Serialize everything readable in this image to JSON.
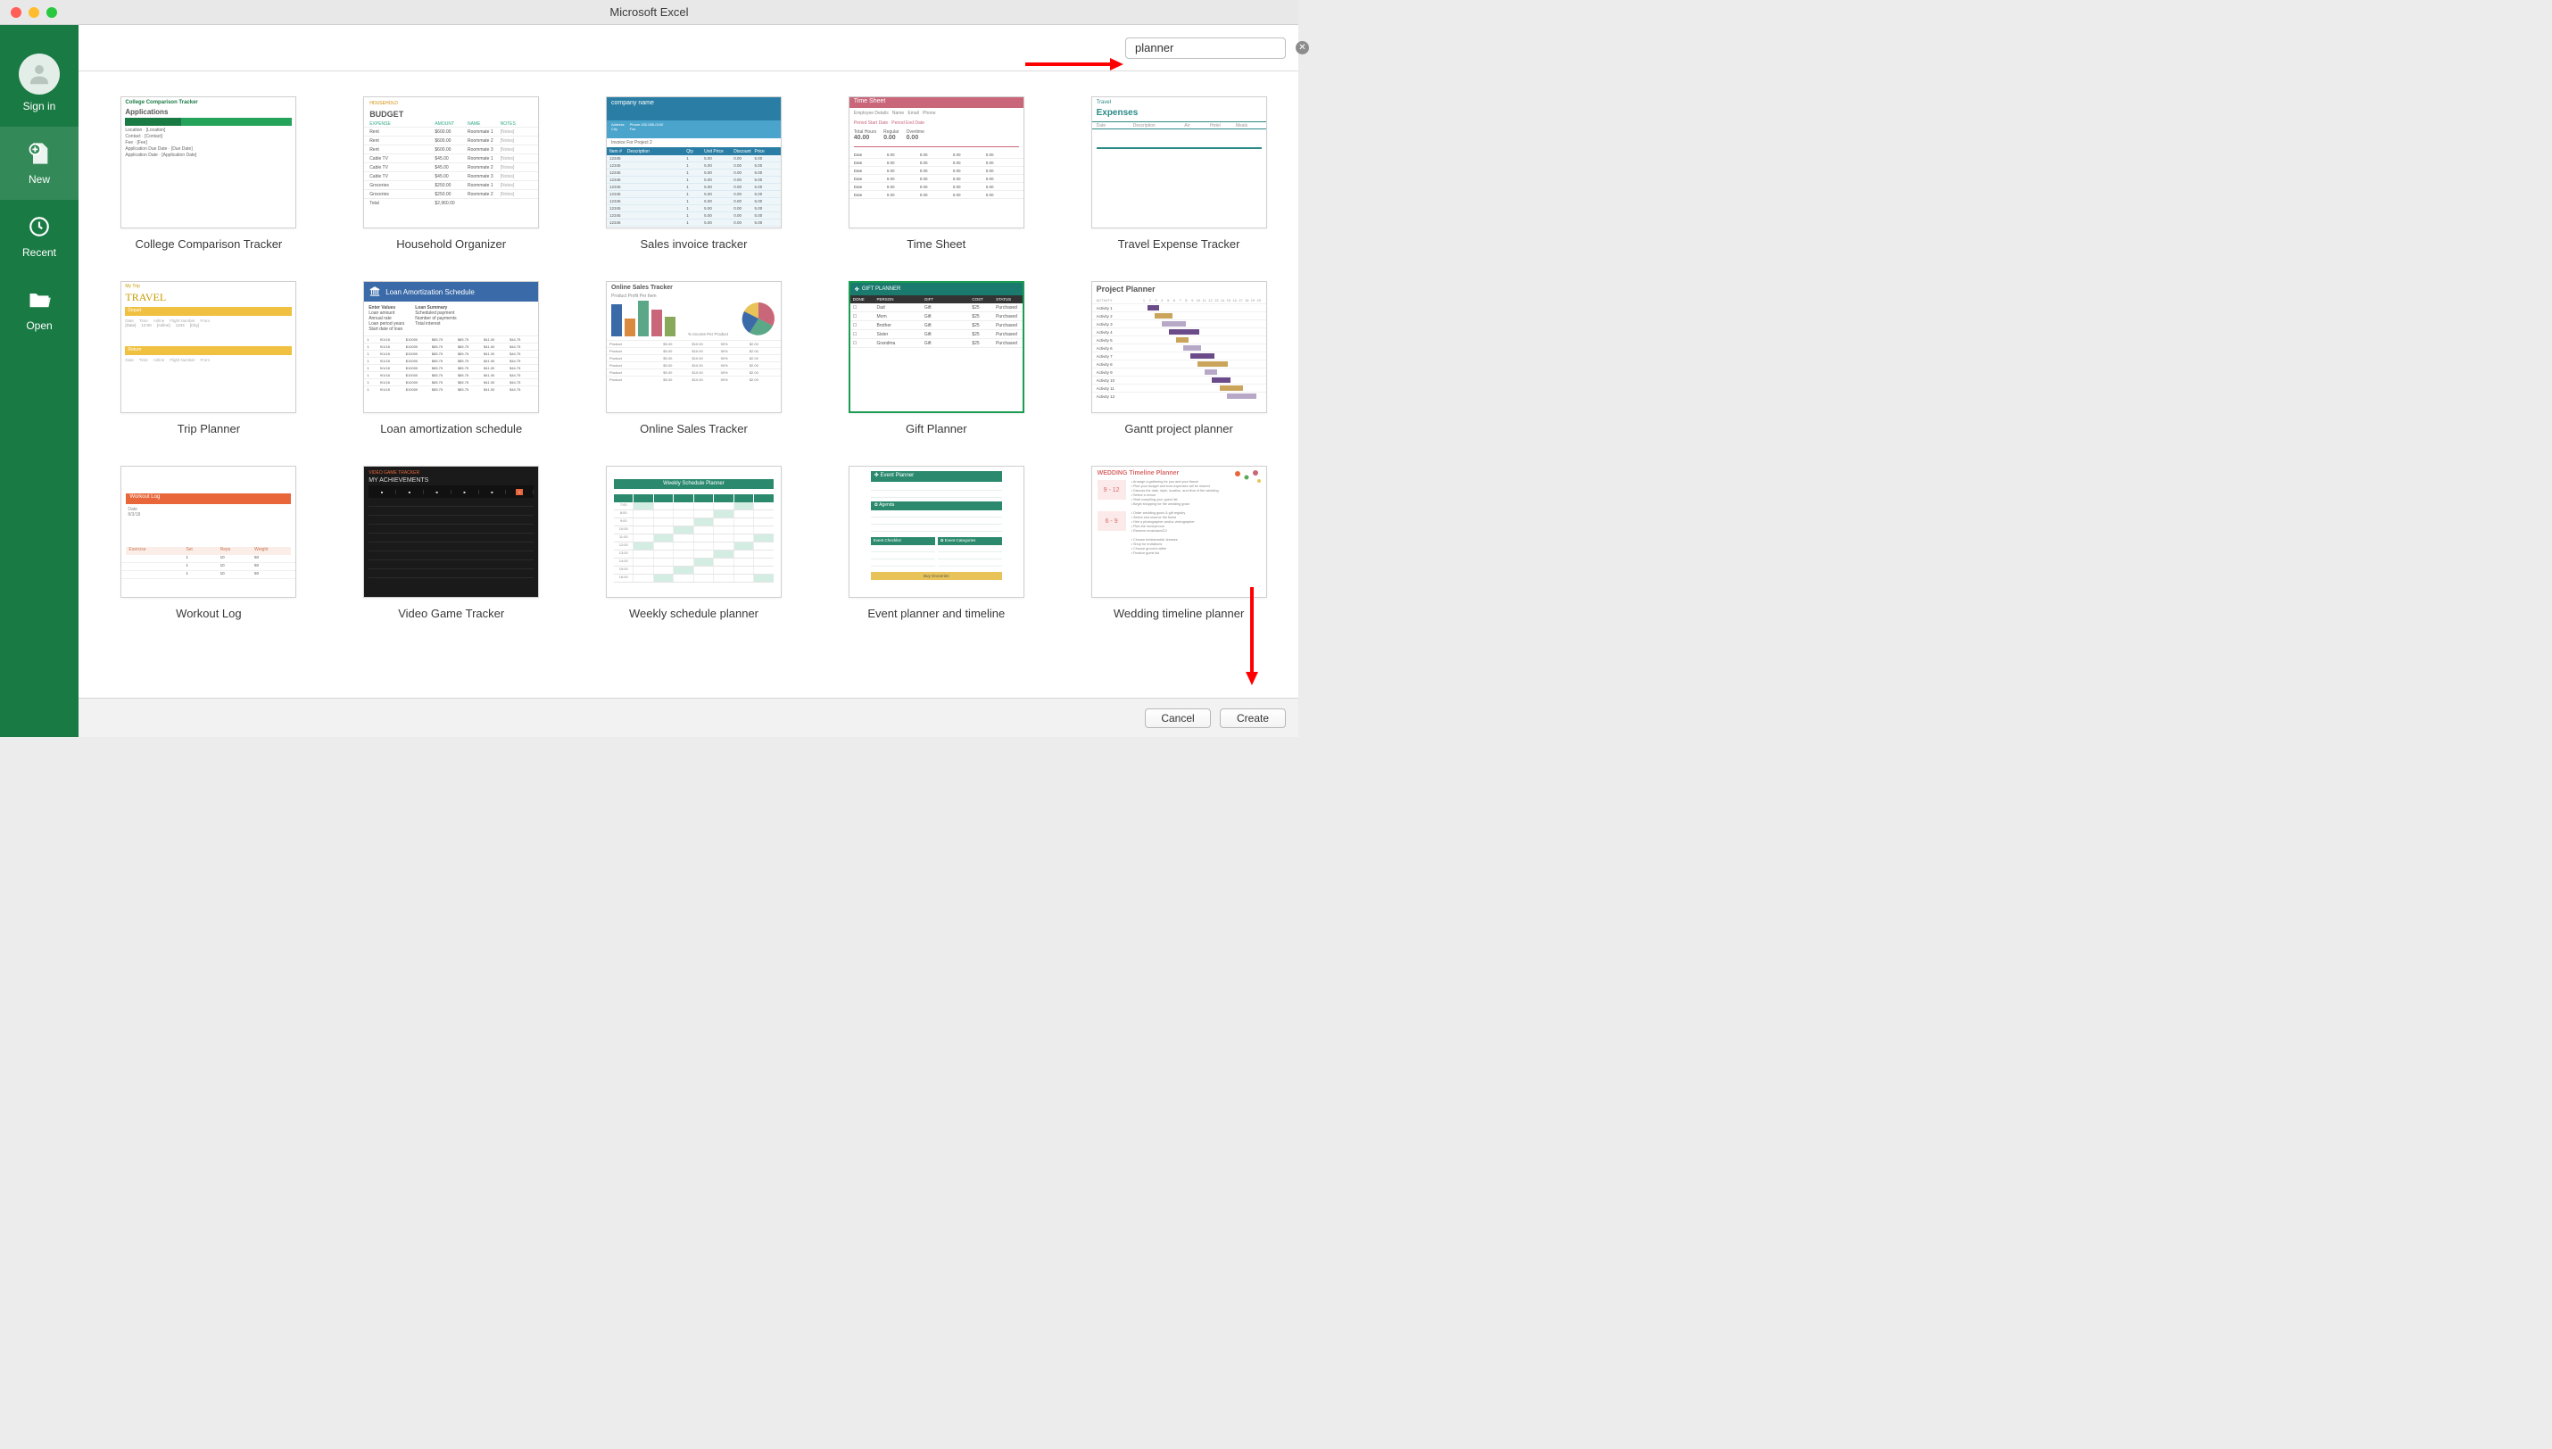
{
  "window": {
    "title": "Microsoft Excel"
  },
  "sidebar": {
    "signin": "Sign in",
    "items": [
      {
        "label": "New",
        "id": "new"
      },
      {
        "label": "Recent",
        "id": "recent"
      },
      {
        "label": "Open",
        "id": "open"
      }
    ]
  },
  "search": {
    "value": "planner",
    "placeholder": "Search"
  },
  "templates": [
    {
      "label": "College Comparison Tracker",
      "kind": "college",
      "selected": false
    },
    {
      "label": "Household Organizer",
      "kind": "budget",
      "selected": false
    },
    {
      "label": "Sales invoice tracker",
      "kind": "invoice",
      "selected": false
    },
    {
      "label": "Time Sheet",
      "kind": "timesheet",
      "selected": false
    },
    {
      "label": "Travel Expense Tracker",
      "kind": "travel",
      "selected": false
    },
    {
      "label": "Trip Planner",
      "kind": "trip",
      "selected": false
    },
    {
      "label": "Loan amortization schedule",
      "kind": "loan",
      "selected": false
    },
    {
      "label": "Online Sales Tracker",
      "kind": "online",
      "selected": false
    },
    {
      "label": "Gift Planner",
      "kind": "gift",
      "selected": true
    },
    {
      "label": "Gantt project planner",
      "kind": "gantt",
      "selected": false
    },
    {
      "label": "Workout Log",
      "kind": "workout",
      "selected": false
    },
    {
      "label": "Video Game Tracker",
      "kind": "videogame",
      "selected": false
    },
    {
      "label": "Weekly schedule planner",
      "kind": "weekly",
      "selected": false
    },
    {
      "label": "Event planner and timeline",
      "kind": "event",
      "selected": false
    },
    {
      "label": "Wedding timeline planner",
      "kind": "wedding",
      "selected": false
    }
  ],
  "footer": {
    "cancel": "Cancel",
    "create": "Create"
  }
}
